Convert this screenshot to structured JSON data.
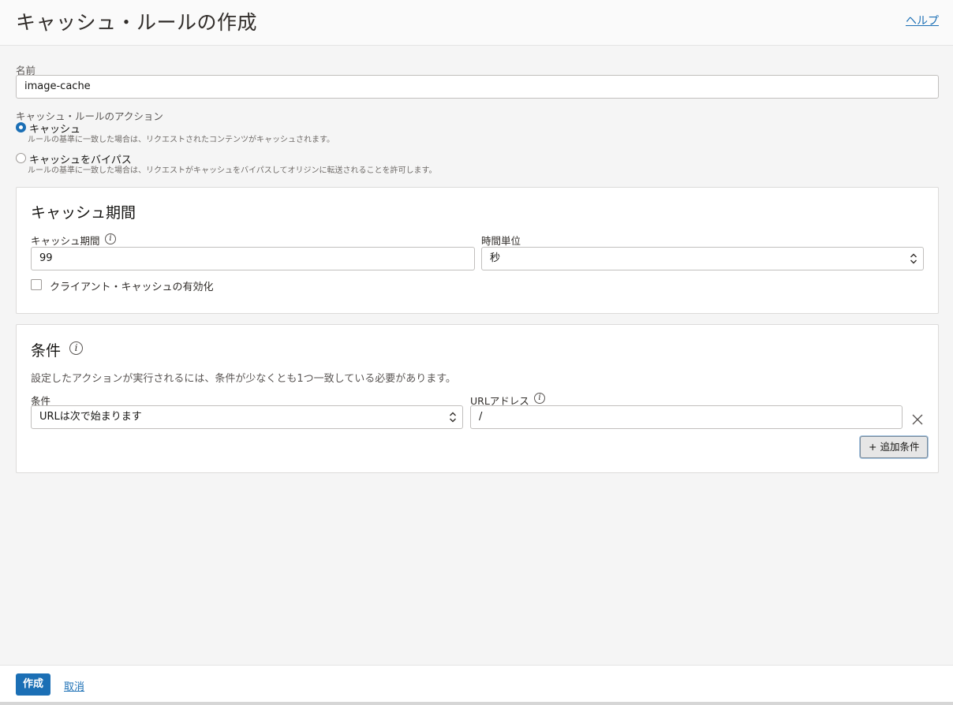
{
  "header": {
    "title": "キャッシュ・ルールの作成",
    "help_label": "ヘルプ"
  },
  "form": {
    "name_label": "名前",
    "name_value": "image-cache",
    "action_label": "キャッシュ・ルールのアクション",
    "actions": [
      {
        "label": "キャッシュ",
        "desc": "ルールの基準に一致した場合は、リクエストされたコンテンツがキャッシュされます。",
        "selected": true
      },
      {
        "label": "キャッシュをバイパス",
        "desc": "ルールの基準に一致した場合は、リクエストがキャッシュをバイパスしてオリジンに転送されることを許可します。",
        "selected": false
      }
    ]
  },
  "cache_period": {
    "title": "キャッシュ期間",
    "period_label": "キャッシュ期間",
    "period_value": "99",
    "unit_label": "時間単位",
    "unit_value": "秒",
    "client_cache_label": "クライアント・キャッシュの有効化",
    "client_cache_checked": false
  },
  "conditions": {
    "title": "条件",
    "description": "設定したアクションが実行されるには、条件が少なくとも1つ一致している必要があります。",
    "condition_label": "条件",
    "condition_value": "URLは次で始まります",
    "url_label": "URLアドレス",
    "url_value": "/",
    "add_label": "+ 追加条件"
  },
  "footer": {
    "create_label": "作成",
    "cancel_label": "取消"
  },
  "colors": {
    "accent": "#1b6fb5",
    "background": "#f5f5f5"
  },
  "icons": {
    "info": "info-icon",
    "close": "close-icon",
    "select": "chevron-updown-icon"
  }
}
